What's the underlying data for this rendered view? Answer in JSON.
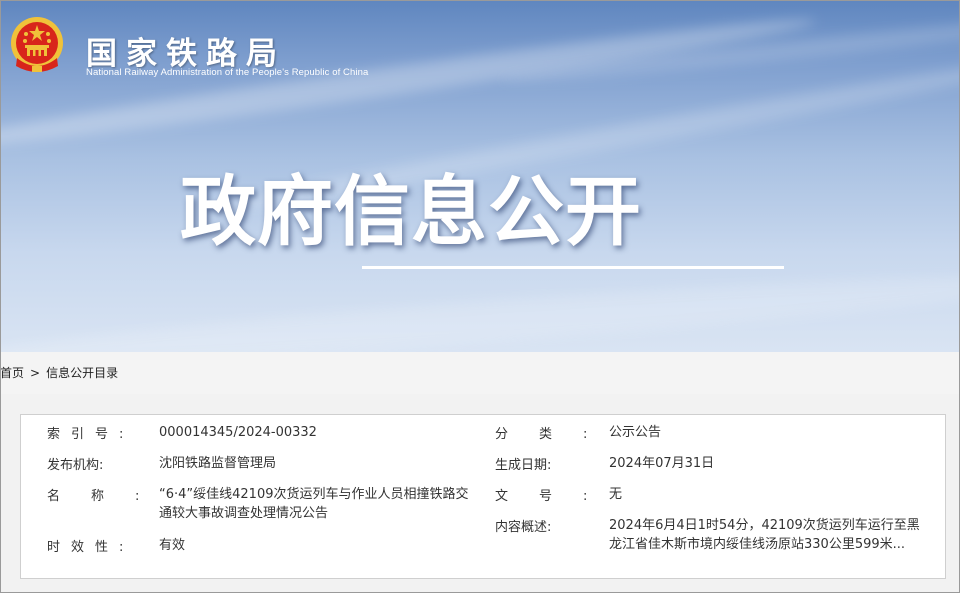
{
  "header": {
    "org_name_cn": "国家铁路局",
    "org_name_en": "National Railway Administration of the People's Republic of China",
    "banner_title": "政府信息公开",
    "emblem_icon": "national-emblem-icon"
  },
  "breadcrumb": {
    "home": "首页",
    "separator": ">",
    "current": "信息公开目录"
  },
  "info": {
    "index_label": "索引号:",
    "index_value": "000014345/2024-00332",
    "category_label": "分类:",
    "category_value": "公示公告",
    "publisher_label": "发布机构:",
    "publisher_value": "沈阳铁路监督管理局",
    "date_label": "生成日期:",
    "date_value": "2024年07月31日",
    "name_label": "名称:",
    "name_value": "“6·4”绥佳线42109次货运列车与作业人员相撞铁路交通较大事故调查处理情况公告",
    "docno_label": "文号:",
    "docno_value": "无",
    "summary_label": "内容概述:",
    "summary_value": "2024年6月4日1时54分，42109次货运列车运行至黑龙江省佳木斯市境内绥佳线汤原站330公里599米...",
    "validity_label": "时效性:",
    "validity_value": "有效"
  },
  "colors": {
    "banner_top": "#5f86bf",
    "banner_bottom": "#d9e4f3",
    "emblem_red": "#d8251b",
    "emblem_gold": "#f0c23a"
  }
}
